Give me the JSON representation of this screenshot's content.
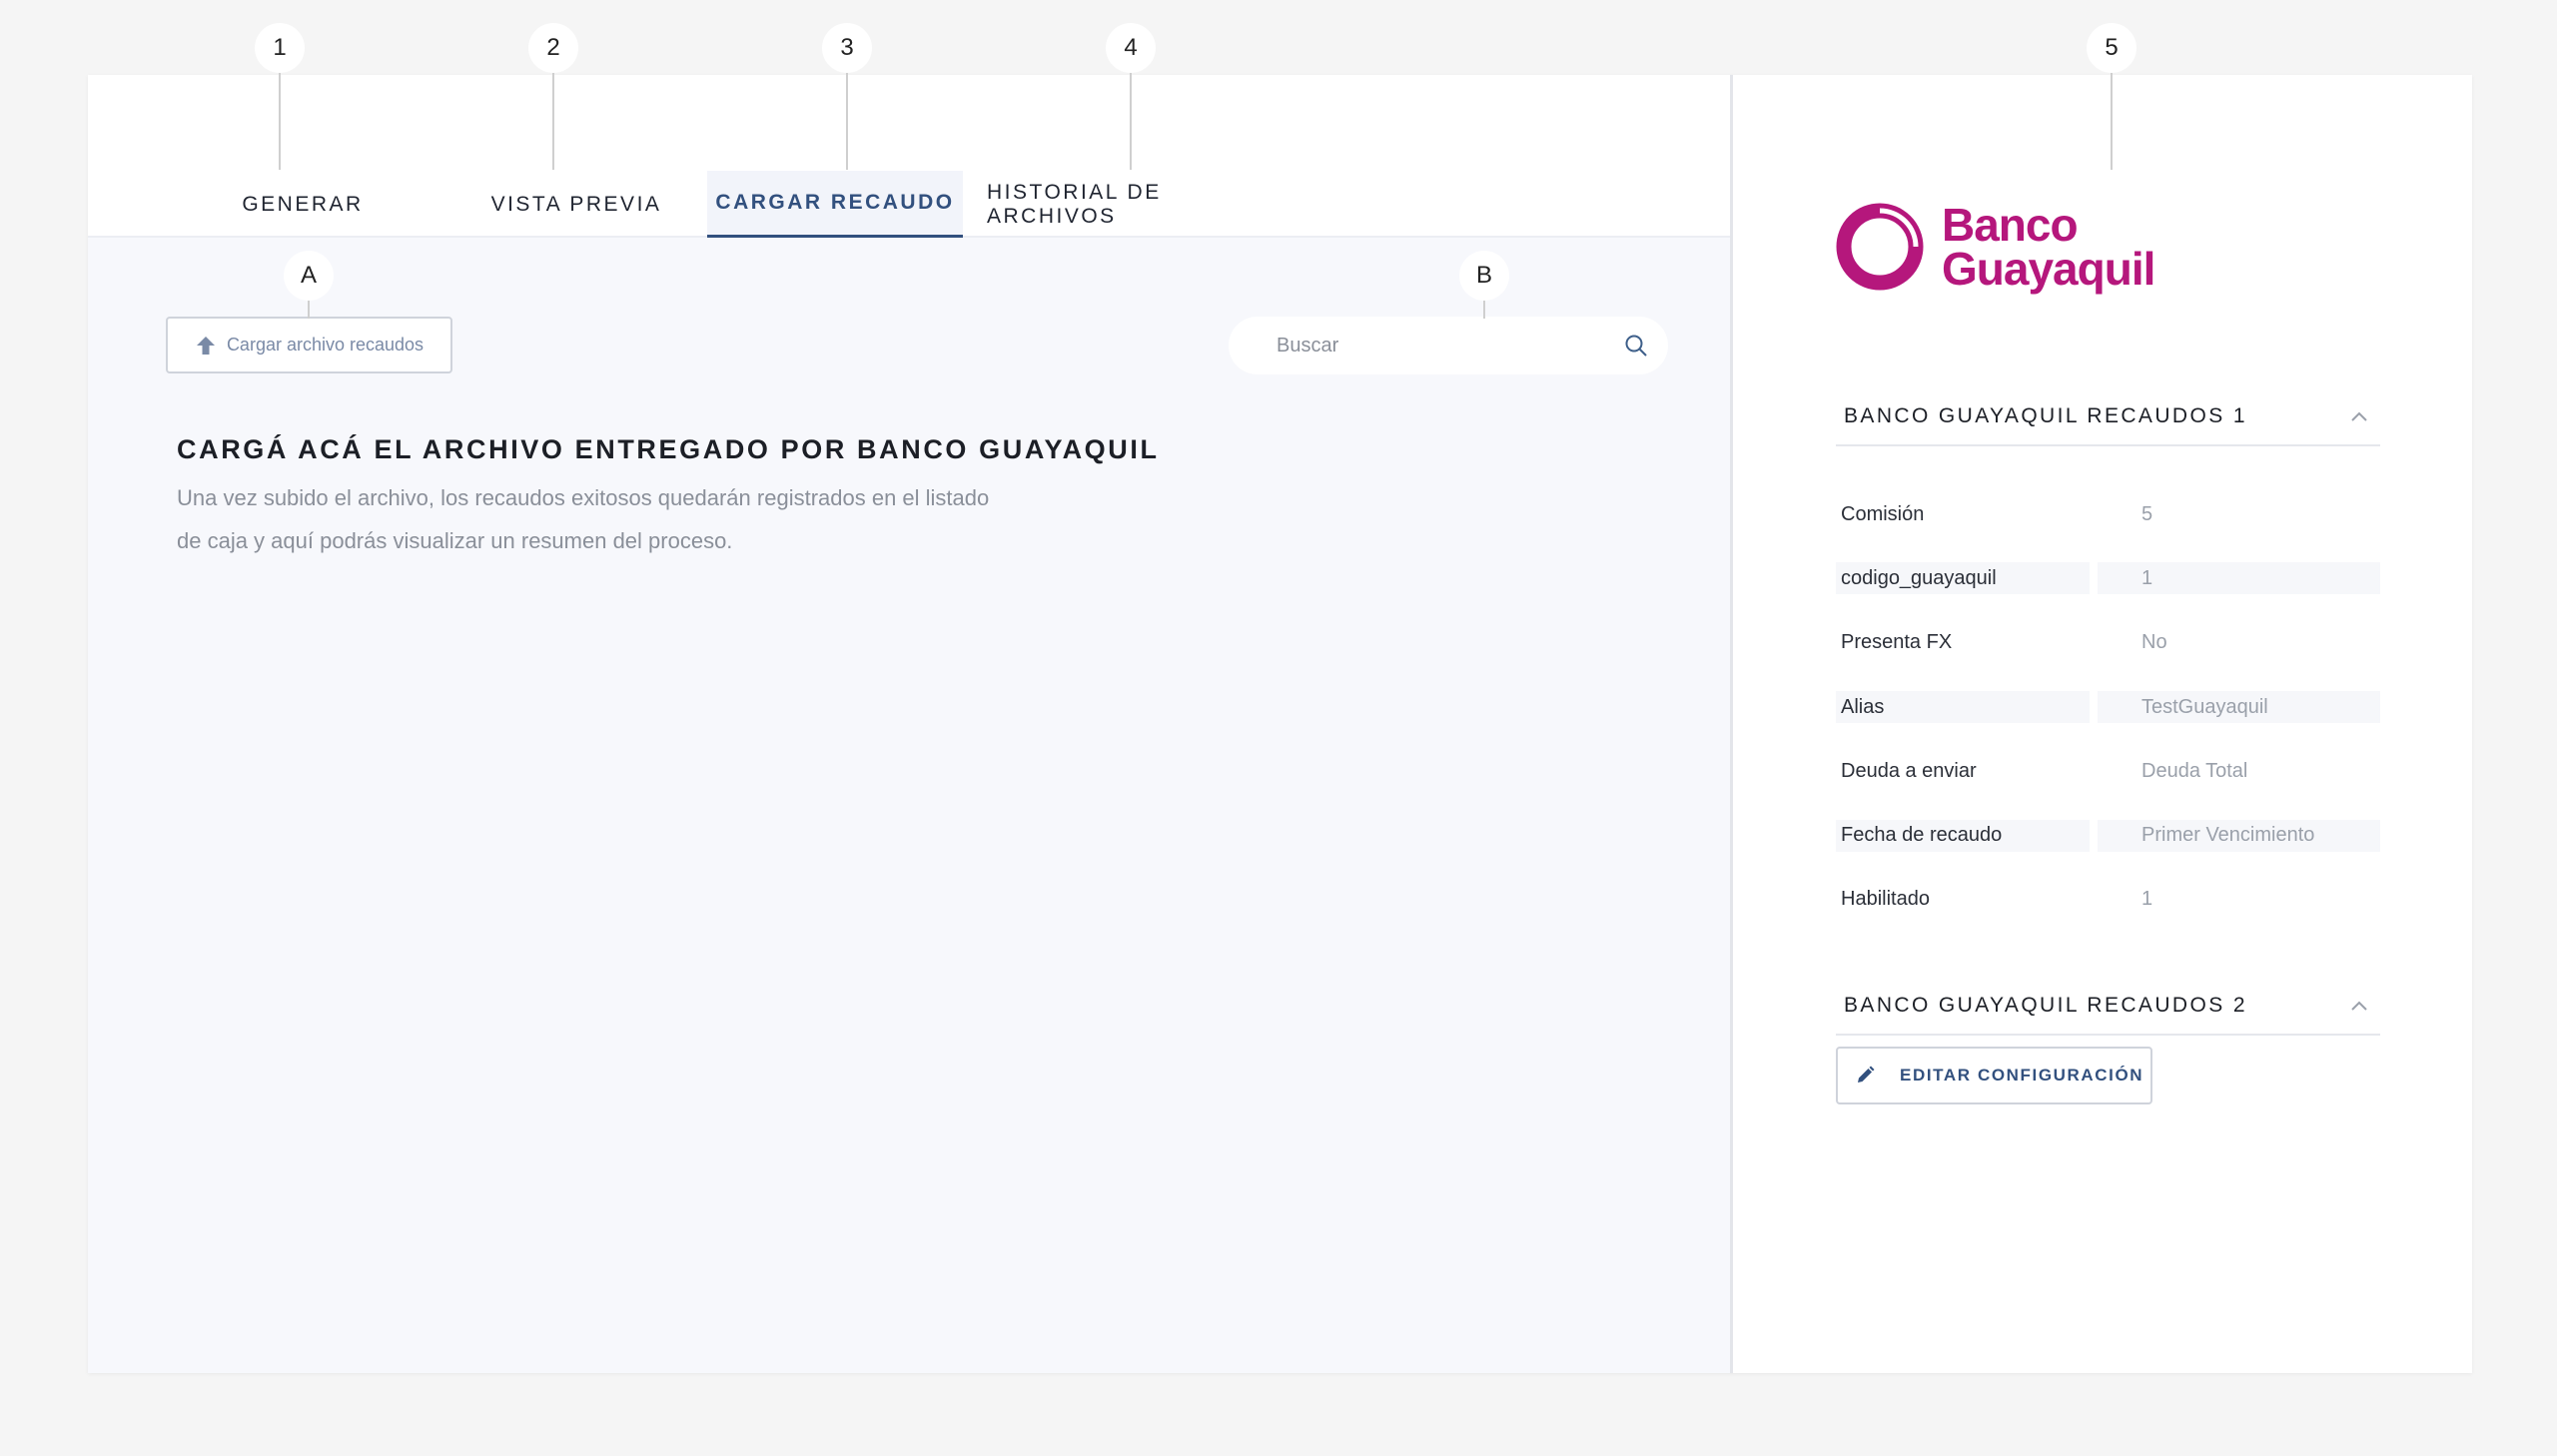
{
  "markers": {
    "tab_generar": "1",
    "tab_vista_previa": "2",
    "tab_cargar_recaudo": "3",
    "tab_historial": "4",
    "right_panel": "5",
    "upload_button": "A",
    "search": "B"
  },
  "tabs": [
    {
      "label": "GENERAR"
    },
    {
      "label": "VISTA PREVIA"
    },
    {
      "label": "CARGAR RECAUDO"
    },
    {
      "label": "HISTORIAL DE ARCHIVOS"
    }
  ],
  "upload": {
    "button_label": "Cargar archivo recaudos",
    "title": "CARGÁ ACÁ EL ARCHIVO ENTREGADO POR BANCO GUAYAQUIL",
    "description_line1": "Una vez subido el archivo, los recaudos exitosos quedarán registrados en el listado",
    "description_line2": "de caja y aquí podrás visualizar un resumen del proceso."
  },
  "search": {
    "placeholder": "Buscar"
  },
  "bank": {
    "logo_line1": "Banco",
    "logo_line2": "Guayaquil",
    "brand_color": "#b5177c"
  },
  "sections": [
    {
      "title": "BANCO GUAYAQUIL RECAUDOS 1",
      "rows": [
        {
          "key": "Comisión",
          "value": "5"
        },
        {
          "key": "codigo_guayaquil",
          "value": "1"
        },
        {
          "key": "Presenta FX",
          "value": "No"
        },
        {
          "key": "Alias",
          "value": "TestGuayaquil"
        },
        {
          "key": "Deuda a enviar",
          "value": "Deuda Total"
        },
        {
          "key": "Fecha de recaudo",
          "value": "Primer Vencimiento"
        },
        {
          "key": "Habilitado",
          "value": "1"
        }
      ]
    },
    {
      "title": "BANCO GUAYAQUIL RECAUDOS 2",
      "rows": []
    }
  ],
  "edit_button_label": "EDITAR CONFIGURACIÓN",
  "colors": {
    "accent": "#32507e",
    "panel_bg": "#f7f8fc"
  }
}
